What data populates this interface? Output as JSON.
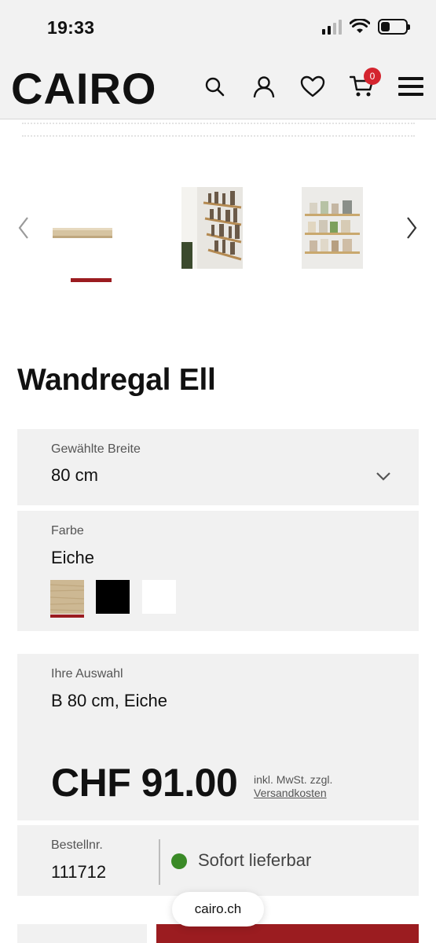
{
  "status_bar": {
    "time": "19:33",
    "battery_level": 0.35
  },
  "header": {
    "logo": "CAIRO",
    "cart_count": "0",
    "icons": [
      "search-icon",
      "account-icon",
      "wishlist-heart-icon",
      "cart-icon",
      "menu-hamburger-icon"
    ]
  },
  "carousel": {
    "thumbnails": [
      "shelf-product-photo",
      "shelf-with-books-photo",
      "shelves-with-magazines-photo"
    ],
    "active_index": 0
  },
  "product": {
    "title": "Wandregal Ell"
  },
  "width_selector": {
    "label": "Gewählte Breite",
    "value": "80 cm"
  },
  "color_selector": {
    "label": "Farbe",
    "value": "Eiche",
    "swatches": [
      {
        "name": "Eiche",
        "color": "#c9b38c"
      },
      {
        "name": "Schwarz",
        "color": "#000000"
      },
      {
        "name": "Weiss",
        "color": "#ffffff"
      }
    ],
    "active_index": 0
  },
  "selection": {
    "label": "Ihre Auswahl",
    "value": "B 80 cm, Eiche",
    "price": "CHF 91.00",
    "price_note": "inkl. MwSt. zzgl.",
    "shipping_link": "Versandkosten"
  },
  "order": {
    "label": "Bestellnr.",
    "number": "111712",
    "availability": "Sofort lieferbar",
    "availability_color": "#3a8a27"
  },
  "browser": {
    "url": "cairo.ch"
  },
  "colors": {
    "accent": "#9b1c20",
    "badge": "#d4252f",
    "panel": "#f1f1f1",
    "header": "#f2f2f2"
  }
}
